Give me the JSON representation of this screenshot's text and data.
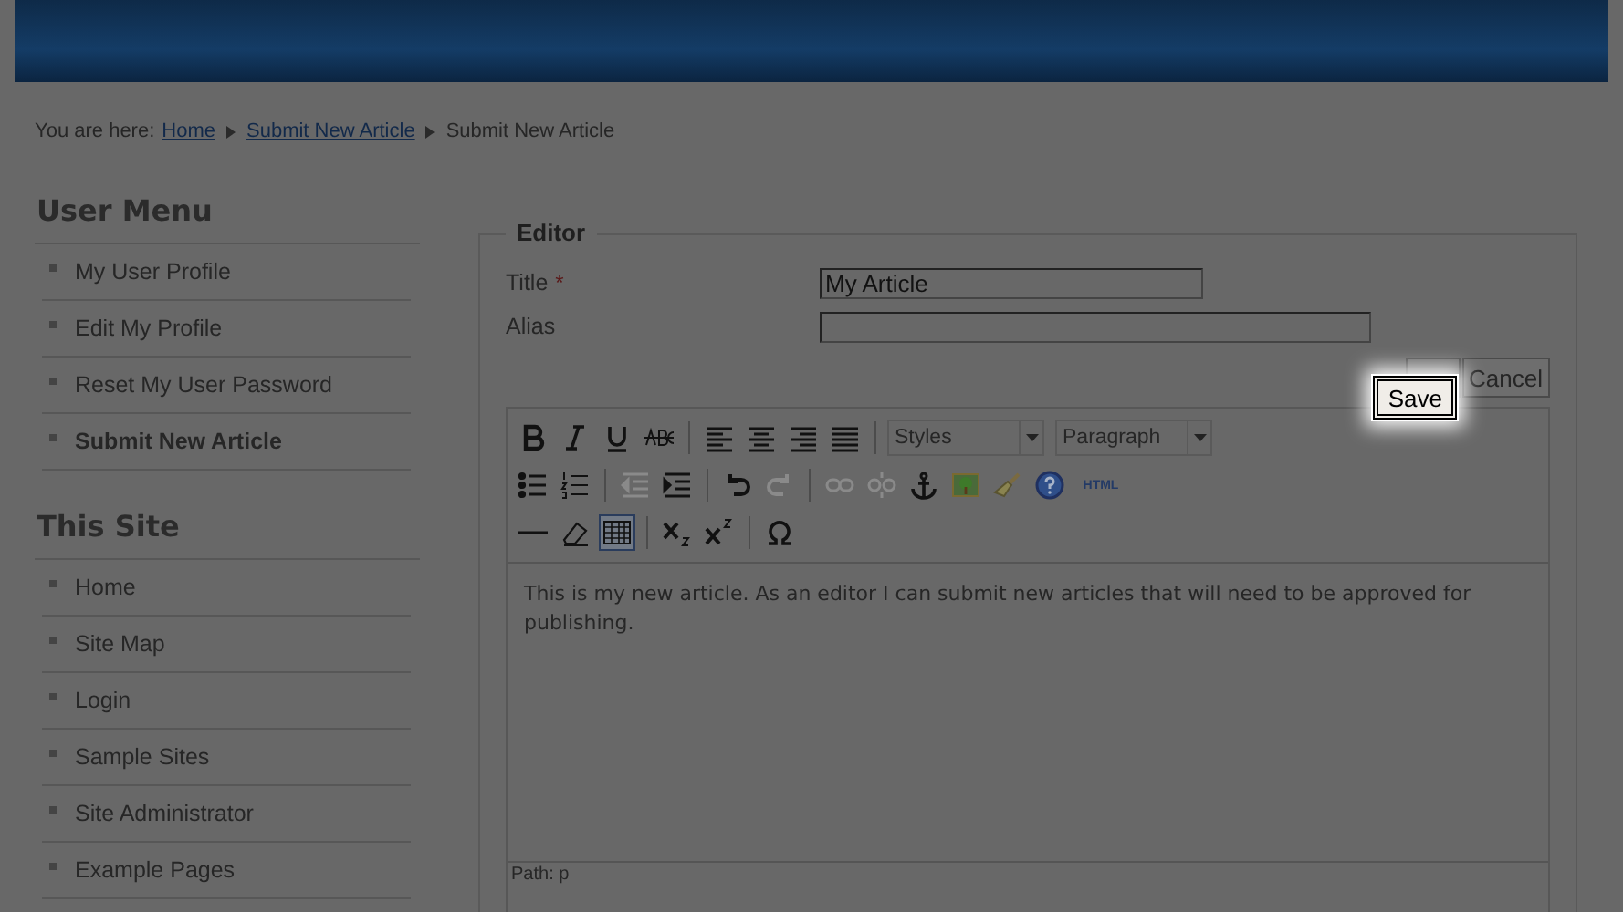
{
  "breadcrumb": {
    "prefix": "You are here:",
    "items": [
      {
        "label": "Home",
        "link": true
      },
      {
        "label": "Submit New Article",
        "link": true
      },
      {
        "label": "Submit New Article",
        "link": false
      }
    ]
  },
  "sidebar": [
    {
      "title": "User Menu",
      "items": [
        {
          "label": "My User Profile",
          "selected": false
        },
        {
          "label": "Edit My Profile",
          "selected": false
        },
        {
          "label": "Reset My User Password",
          "selected": false
        },
        {
          "label": "Submit New Article",
          "selected": true
        }
      ]
    },
    {
      "title": "This Site",
      "items": [
        {
          "label": "Home",
          "selected": false
        },
        {
          "label": "Site Map",
          "selected": false
        },
        {
          "label": "Login",
          "selected": false
        },
        {
          "label": "Sample Sites",
          "selected": false
        },
        {
          "label": "Site Administrator",
          "selected": false
        },
        {
          "label": "Example Pages",
          "selected": false
        }
      ]
    }
  ],
  "editor": {
    "legend": "Editor",
    "fields": [
      {
        "label": "Title",
        "required": true,
        "value": "My Article"
      },
      {
        "label": "Alias",
        "required": false
      }
    ],
    "required_mark": "*",
    "buttons": [
      {
        "label": "Cancel"
      }
    ],
    "highlighted_button": {
      "label": "Save"
    },
    "toolbar": [
      [
        {
          "kind": "bold",
          "disabled": false,
          "selected": false
        },
        {
          "kind": "italic",
          "disabled": false,
          "selected": false
        },
        {
          "kind": "underline",
          "disabled": false,
          "selected": false
        },
        {
          "kind": "strike",
          "disabled": false,
          "selected": false
        },
        {
          "kind": "sep"
        },
        {
          "kind": "align-left",
          "disabled": false,
          "selected": false
        },
        {
          "kind": "align-center",
          "disabled": false,
          "selected": false
        },
        {
          "kind": "align-right",
          "disabled": false,
          "selected": false
        },
        {
          "kind": "justify",
          "disabled": false,
          "selected": false
        },
        {
          "kind": "sep"
        },
        {
          "kind": "select",
          "label": "Styles"
        },
        {
          "kind": "select",
          "label": "Paragraph"
        }
      ],
      [
        {
          "kind": "bullets",
          "disabled": false,
          "selected": false
        },
        {
          "kind": "numbers",
          "disabled": false,
          "selected": false
        },
        {
          "kind": "sep"
        },
        {
          "kind": "outdent",
          "disabled": true,
          "selected": false
        },
        {
          "kind": "indent",
          "disabled": false,
          "selected": false
        },
        {
          "kind": "sep"
        },
        {
          "kind": "undo",
          "disabled": false,
          "selected": false
        },
        {
          "kind": "redo",
          "disabled": true,
          "selected": false
        },
        {
          "kind": "sep"
        },
        {
          "kind": "link",
          "disabled": true,
          "selected": false
        },
        {
          "kind": "unlink",
          "disabled": true,
          "selected": false
        },
        {
          "kind": "anchor",
          "disabled": false,
          "selected": false
        },
        {
          "kind": "image",
          "disabled": false,
          "selected": false
        },
        {
          "kind": "cleanup",
          "disabled": false,
          "selected": false
        },
        {
          "kind": "help",
          "disabled": false,
          "selected": false
        },
        {
          "kind": "html",
          "label": "HTML",
          "disabled": false,
          "selected": false
        }
      ],
      [
        {
          "kind": "hr",
          "disabled": false,
          "selected": false
        },
        {
          "kind": "eraser",
          "disabled": false,
          "selected": false
        },
        {
          "kind": "table",
          "disabled": false,
          "selected": true
        },
        {
          "kind": "sep"
        },
        {
          "kind": "sub",
          "disabled": false,
          "selected": false
        },
        {
          "kind": "sup",
          "disabled": false,
          "selected": false
        },
        {
          "kind": "sep"
        },
        {
          "kind": "omega",
          "disabled": false,
          "selected": false
        }
      ]
    ],
    "content": "This is my new article. As an editor I can submit new articles that will need to be approved for publishing.",
    "path": "Path: p"
  }
}
